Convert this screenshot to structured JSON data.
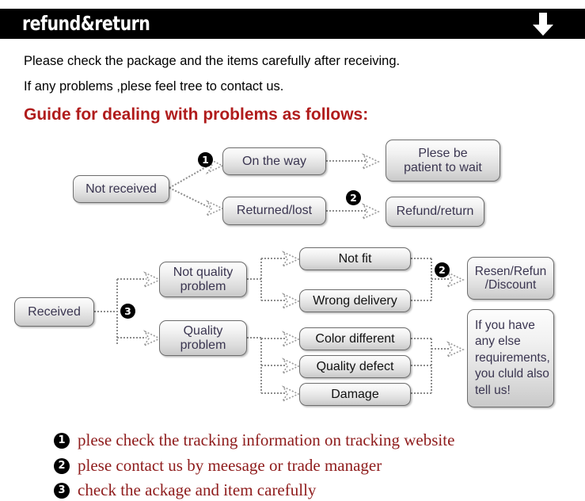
{
  "banner": {
    "title": "refund&return",
    "arrow_icon": "arrow-down-icon"
  },
  "intro": {
    "line1": "Please check the package and the items carefully after receiving.",
    "line2": "If any problems ,plese feel tree to contact us."
  },
  "guide_heading": "Guide for dealing with problems as follows:",
  "flow_top": {
    "source": "Not received",
    "branches": [
      {
        "label": "On the way",
        "result": "Plese be\npatient to wait",
        "badge": "❶"
      },
      {
        "label": "Returned/lost",
        "result": "Refund/return",
        "badge": "❷"
      }
    ]
  },
  "flow_bottom": {
    "source": "Received",
    "source_badge": "❸",
    "not_quality": "Not quality\nproblem",
    "quality": "Quality\nproblem",
    "not_quality_items": [
      "Not fit",
      "Wrong delivery"
    ],
    "quality_items": [
      "Color different",
      "Quality defect",
      "Damage"
    ],
    "resolution": "Resen/Refun\n/Discount",
    "resolution_badge": "❷",
    "note": "If you have\nany else\nrequirements,\nyou cluld also\ntell us!"
  },
  "legend": [
    {
      "badge": "❶",
      "text": "plese check the tracking information on tracking website"
    },
    {
      "badge": "❷",
      "text": "plese contact us by meesage or trade manager"
    },
    {
      "badge": "❸",
      "text": "check the ackage and item carefully"
    }
  ],
  "colors": {
    "banner_bg": "#000000",
    "heading_red": "#b01c1c",
    "legend_red": "#8e1b1b",
    "box_text": "#3a3550"
  }
}
